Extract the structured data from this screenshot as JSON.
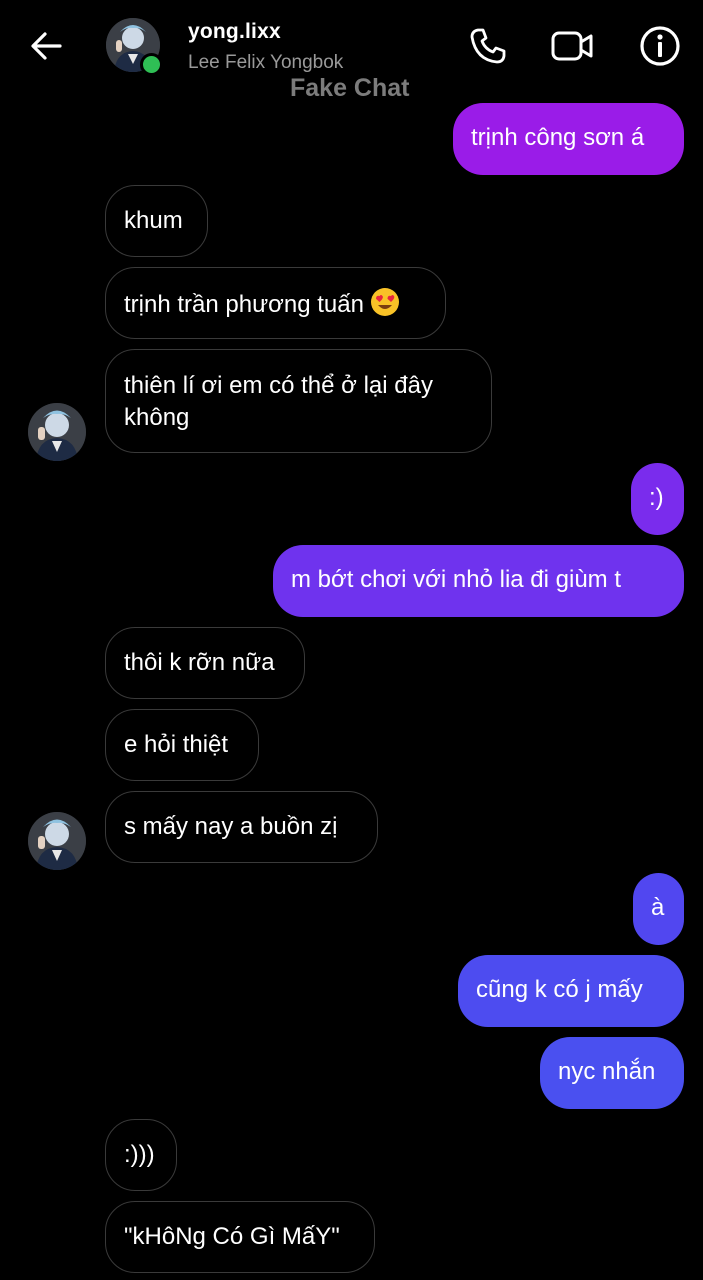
{
  "header": {
    "username": "yong.lixx",
    "full_name": "Lee Felix Yongbok",
    "watermark": "Fake Chat"
  },
  "icons": {
    "back": "arrow-left-icon",
    "call": "phone-icon",
    "video": "video-camera-icon",
    "info": "info-icon",
    "emoji": "heart-eyes-emoji"
  },
  "colors": {
    "background": "#000000",
    "outgoing_top": "#9b1be8",
    "outgoing_mid": "#6c35f0",
    "outgoing_bottom": "#4d4ef0",
    "incoming_border": "#3a3a3a",
    "online": "#2fbf55"
  },
  "messages": [
    {
      "sender": "me",
      "text": "trịnh công sơn á"
    },
    {
      "sender": "them",
      "text": "khum"
    },
    {
      "sender": "them",
      "text": "trịnh trần phương tuấn"
    },
    {
      "sender": "them",
      "text": "thiên lí ơi em có thể ở lại đây",
      "text2": "không"
    },
    {
      "sender": "me",
      "text": ":)"
    },
    {
      "sender": "me",
      "text": "m bớt chơi với nhỏ lia đi giùm t"
    },
    {
      "sender": "them",
      "text": "thôi k rỡn nữa"
    },
    {
      "sender": "them",
      "text": "e hỏi thiệt"
    },
    {
      "sender": "them",
      "text": "s mấy nay a buồn zị"
    },
    {
      "sender": "me",
      "text": "à"
    },
    {
      "sender": "me",
      "text": "cũng k có j mấy"
    },
    {
      "sender": "me",
      "text": "nyc nhắn"
    },
    {
      "sender": "them",
      "text": ":)))"
    },
    {
      "sender": "them",
      "text": "\"kHôNg Có Gì MấY\""
    }
  ]
}
